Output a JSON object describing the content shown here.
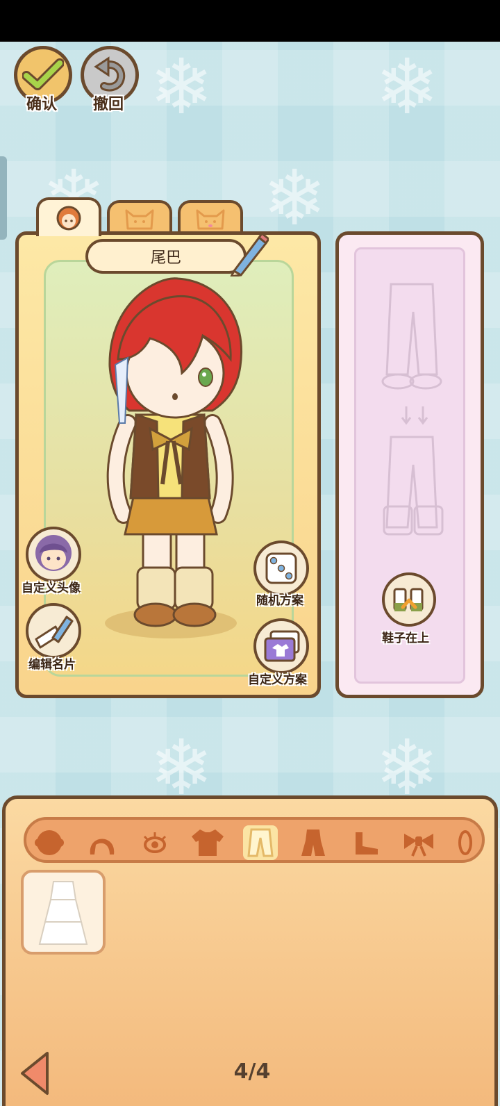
{
  "top_buttons": {
    "confirm_label": "确认",
    "undo_label": "撤回"
  },
  "tabs": [
    {
      "icon": "girl-face-icon",
      "active": true
    },
    {
      "icon": "cat-face-icon",
      "active": false
    },
    {
      "icon": "cat-face-icon",
      "active": false
    }
  ],
  "character_panel": {
    "name": "尾巴",
    "actions": {
      "custom_avatar": "自定义头像",
      "edit_card": "编辑名片",
      "random_outfit": "随机方案",
      "custom_outfit": "自定义方案"
    }
  },
  "layer_panel": {
    "shoes_on_top": "鞋子在上"
  },
  "wardrobe": {
    "categories": [
      {
        "name": "face-icon",
        "active": false
      },
      {
        "name": "hair-icon",
        "active": false
      },
      {
        "name": "eye-icon",
        "active": false
      },
      {
        "name": "top-icon",
        "active": false
      },
      {
        "name": "pants-icon",
        "active": true
      },
      {
        "name": "dress-icon",
        "active": false
      },
      {
        "name": "shoe-icon",
        "active": false
      },
      {
        "name": "bow-icon",
        "active": false
      }
    ],
    "items": [
      {
        "name": "white-tiered-skirt-icon"
      }
    ],
    "page": "4/4"
  },
  "colors": {
    "outline": "#6b4a2d",
    "background": "#bfe0e6",
    "confirm_green": "#a8d44a",
    "undo_gray": "#b0b0b0",
    "hair_red": "#d9362f"
  }
}
